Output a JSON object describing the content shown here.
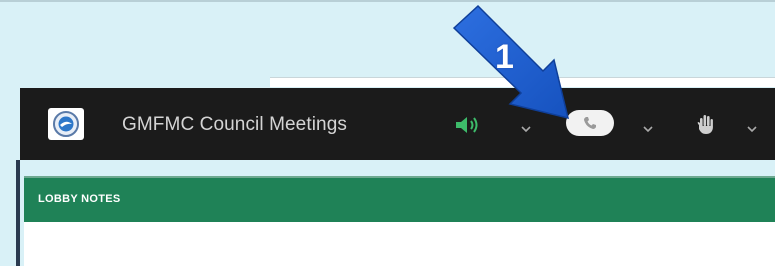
{
  "app_bar": {
    "title": "GMFMC Council Meetings",
    "logo_icon": "council-seal-logo",
    "audio_icon": "speaker-icon",
    "phone_icon": "phone-icon",
    "raise_hand_icon": "raise-hand-icon"
  },
  "pods": {
    "lobby_notes_title": "LOBBY NOTES"
  },
  "annotation": {
    "step_number": "1",
    "arrow_color": "#1c5fd0"
  },
  "colors": {
    "app_bar": "#1b1b1b",
    "pod_header": "#1f8257",
    "speaker_active": "#3dbb6a",
    "background": "#d9f1f7"
  }
}
